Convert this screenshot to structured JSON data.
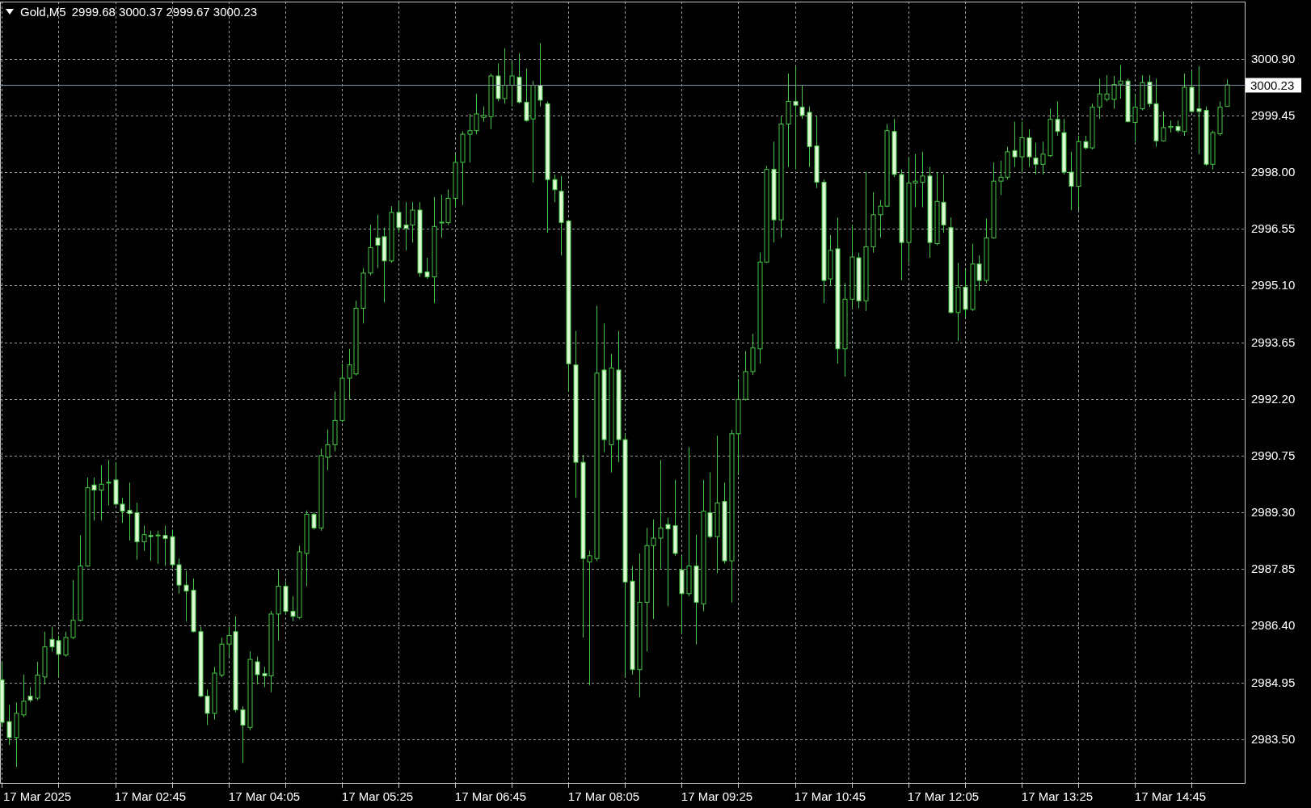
{
  "chart": {
    "header": {
      "symbol": "Gold,M5",
      "ohlc": "2999.68 3000.37 2999.67 3000.23"
    },
    "chart_data": {
      "type": "candlestick",
      "grid": true,
      "ylim": [
        2982.36,
        3002.36
      ],
      "categories": [
        null,
        null,
        null,
        null,
        null,
        "17 Mar 2025",
        null,
        null,
        null,
        null,
        null,
        null,
        null,
        null,
        null,
        null,
        null,
        null,
        null,
        null,
        null,
        "17 Mar 02:45",
        null,
        null,
        null,
        null,
        null,
        null,
        null,
        null,
        null,
        null,
        null,
        null,
        null,
        null,
        null,
        "17 Mar 04:05",
        null,
        null,
        null,
        null,
        null,
        null,
        null,
        null,
        null,
        null,
        null,
        null,
        null,
        null,
        null,
        "17 Mar 05:25",
        null,
        null,
        null,
        null,
        null,
        null,
        null,
        null,
        null,
        null,
        null,
        null,
        null,
        null,
        null,
        "17 Mar 06:45",
        null,
        null,
        null,
        null,
        null,
        null,
        null,
        null,
        null,
        null,
        null,
        null,
        null,
        null,
        null,
        "17 Mar 08:05",
        null,
        null,
        null,
        null,
        null,
        null,
        null,
        null,
        null,
        null,
        null,
        null,
        null,
        null,
        null,
        "17 Mar 09:25",
        null,
        null,
        null,
        null,
        null,
        null,
        null,
        null,
        null,
        null,
        null,
        null,
        null,
        null,
        null,
        "17 Mar 10:45",
        null,
        null,
        null,
        null,
        null,
        null,
        null,
        null,
        null,
        null,
        null,
        null,
        null,
        null,
        null,
        "17 Mar 12:05",
        null,
        null,
        null,
        null,
        null,
        null,
        null,
        null,
        null,
        null,
        null,
        null,
        null,
        null,
        null,
        "17 Mar 13:25",
        null,
        null,
        null,
        null,
        null,
        null,
        null,
        null,
        null,
        null,
        null,
        null,
        null,
        null,
        null,
        "17 Mar 14:45",
        null,
        null,
        null,
        null,
        null,
        null,
        null,
        null
      ],
      "yticks": [
        {
          "value": 3000.9,
          "label": "3000.90"
        },
        {
          "value": 2999.45,
          "label": "2999.45"
        },
        {
          "value": 2998,
          "label": "2998.00"
        },
        {
          "value": 2996.55,
          "label": "2996.55"
        },
        {
          "value": 2995.1,
          "label": "2995.10"
        },
        {
          "value": 2993.65,
          "label": "2993.65"
        },
        {
          "value": 2992.2,
          "label": "2992.20"
        },
        {
          "value": 2990.75,
          "label": "2990.75"
        },
        {
          "value": 2989.3,
          "label": "2989.30"
        },
        {
          "value": 2987.85,
          "label": "2987.85"
        },
        {
          "value": 2986.4,
          "label": "2986.40"
        },
        {
          "value": 2984.95,
          "label": "2984.95"
        },
        {
          "value": 2983.5,
          "label": "2983.50"
        }
      ],
      "ohlc": [
        [
          2985.02,
          2985.48,
          2983.8,
          2983.93
        ],
        [
          2983.95,
          2984.38,
          2983.35,
          2983.54
        ],
        [
          2983.54,
          2984.44,
          2982.79,
          2984.16
        ],
        [
          2984.12,
          2985.15,
          2984.06,
          2984.47
        ],
        [
          2984.6,
          2984.83,
          2984.44,
          2984.5
        ],
        [
          2984.55,
          2985.48,
          2984.5,
          2985.14
        ],
        [
          2985.09,
          2986.25,
          2984.9,
          2985.86
        ],
        [
          2986.05,
          2986.38,
          2985.74,
          2985.86
        ],
        [
          2986.02,
          2986.15,
          2985.09,
          2985.67
        ],
        [
          2985.65,
          2986.25,
          2985.61,
          2986.1
        ],
        [
          2986.1,
          2987.57,
          2986.06,
          2986.54
        ],
        [
          2986.54,
          2988.71,
          2986.51,
          2987.93
        ],
        [
          2987.93,
          2990.19,
          2987.91,
          2989.93
        ],
        [
          2990.0,
          2990.19,
          2989.09,
          2989.87
        ],
        [
          2989.87,
          2990.51,
          2989.09,
          2990.02
        ],
        [
          2990.06,
          2990.64,
          2989.48,
          2990.07
        ],
        [
          2990.13,
          2990.58,
          2989.48,
          2989.51
        ],
        [
          2989.51,
          2989.67,
          2989.03,
          2989.33
        ],
        [
          2989.35,
          2990.06,
          2988.58,
          2989.27
        ],
        [
          2989.29,
          2989.54,
          2988.09,
          2988.55
        ],
        [
          2988.55,
          2988.96,
          2988.32,
          2988.73
        ],
        [
          2988.71,
          2988.83,
          2988.06,
          2988.68
        ],
        [
          2988.71,
          2988.83,
          2987.99,
          2988.72
        ],
        [
          2988.71,
          2988.96,
          2987.93,
          2988.63
        ],
        [
          2988.68,
          2988.86,
          2987.87,
          2987.96
        ],
        [
          2987.96,
          2988.12,
          2987.22,
          2987.44
        ],
        [
          2987.44,
          2987.8,
          2986.51,
          2987.29
        ],
        [
          2987.31,
          2987.61,
          2986.23,
          2986.25
        ],
        [
          2986.25,
          2986.38,
          2984.57,
          2984.6
        ],
        [
          2984.6,
          2984.77,
          2983.86,
          2984.16
        ],
        [
          2984.16,
          2985.35,
          2984.0,
          2985.19
        ],
        [
          2985.14,
          2986.1,
          2985.09,
          2985.93
        ],
        [
          2985.93,
          2986.38,
          2985.61,
          2986.15
        ],
        [
          2986.25,
          2986.64,
          2984.19,
          2984.25
        ],
        [
          2984.25,
          2984.34,
          2982.89,
          2983.86
        ],
        [
          2983.8,
          2985.74,
          2983.73,
          2985.54
        ],
        [
          2985.48,
          2985.61,
          2984.9,
          2985.15
        ],
        [
          2985.18,
          2985.35,
          2984.83,
          2985.12
        ],
        [
          2985.12,
          2986.78,
          2984.7,
          2986.7
        ],
        [
          2986.7,
          2987.83,
          2986.02,
          2987.41
        ],
        [
          2987.41,
          2987.54,
          2986.7,
          2986.77
        ],
        [
          2986.77,
          2987.16,
          2986.51,
          2986.64
        ],
        [
          2986.61,
          2988.45,
          2986.57,
          2988.29
        ],
        [
          2988.25,
          2989.35,
          2987.41,
          2989.25
        ],
        [
          2989.25,
          2989.3,
          2988.86,
          2988.9
        ],
        [
          2988.9,
          2990.93,
          2988.83,
          2990.75
        ],
        [
          2990.71,
          2991.42,
          2990.38,
          2991.03
        ],
        [
          2991.03,
          2992.39,
          2990.86,
          2991.65
        ],
        [
          2991.65,
          2993.1,
          2991.61,
          2992.73
        ],
        [
          2992.73,
          2993.48,
          2992.19,
          2993.07
        ],
        [
          2992.84,
          2994.71,
          2992.8,
          2994.52
        ],
        [
          2994.52,
          2995.55,
          2994.13,
          2995.42
        ],
        [
          2995.42,
          2996.65,
          2995.36,
          2996.07
        ],
        [
          2996.32,
          2996.91,
          2995.55,
          2996.13
        ],
        [
          2996.35,
          2996.58,
          2994.67,
          2995.73
        ],
        [
          2995.73,
          2997.13,
          2995.68,
          2996.97
        ],
        [
          2996.97,
          2997.25,
          2996.45,
          2996.58
        ],
        [
          2996.65,
          2997.23,
          2996.0,
          2996.56
        ],
        [
          2996.65,
          2997.23,
          2996.2,
          2997.03
        ],
        [
          2997.03,
          2997.23,
          2995.32,
          2995.42
        ],
        [
          2995.45,
          2995.81,
          2995.27,
          2995.32
        ],
        [
          2995.32,
          2997.36,
          2994.65,
          2996.61
        ],
        [
          2996.71,
          2997.42,
          2996.32,
          2996.72
        ],
        [
          2996.71,
          2997.55,
          2996.65,
          2997.33
        ],
        [
          2997.33,
          2998.46,
          2997.1,
          2998.25
        ],
        [
          2998.25,
          2999.04,
          2997.16,
          2998.97
        ],
        [
          2998.97,
          2999.49,
          2998.25,
          2999.06
        ],
        [
          2999.06,
          3000.0,
          2998.97,
          2999.49
        ],
        [
          2999.4,
          2999.68,
          2999.29,
          2999.45
        ],
        [
          2999.42,
          3000.52,
          2999.1,
          3000.46
        ],
        [
          3000.46,
          3000.78,
          2999.81,
          2999.88
        ],
        [
          2999.88,
          3001.17,
          2999.75,
          3000.22
        ],
        [
          3000.22,
          3000.84,
          2999.68,
          3000.46
        ],
        [
          3000.43,
          3001.04,
          2999.75,
          2999.79
        ],
        [
          2999.79,
          3000.65,
          2999.29,
          2999.32
        ],
        [
          2999.36,
          3000.33,
          2997.74,
          3000.22
        ],
        [
          3000.22,
          3001.3,
          2999.68,
          2999.84
        ],
        [
          2999.75,
          2999.81,
          2996.45,
          2997.81
        ],
        [
          2997.81,
          2997.94,
          2997.23,
          2997.55
        ],
        [
          2997.51,
          2997.9,
          2995.87,
          2996.71
        ],
        [
          2996.75,
          2996.78,
          2992.39,
          2993.1
        ],
        [
          2993.07,
          2993.94,
          2989.67,
          2990.58
        ],
        [
          2990.58,
          2990.77,
          2986.1,
          2988.12
        ],
        [
          2988.03,
          2988.32,
          2984.87,
          2988.19
        ],
        [
          2988.12,
          2994.58,
          2988.06,
          2992.86
        ],
        [
          2992.94,
          2994.13,
          2990.84,
          2991.16
        ],
        [
          2991.03,
          2993.35,
          2990.32,
          2992.99
        ],
        [
          2992.94,
          2993.94,
          2990.58,
          2991.16
        ],
        [
          2991.16,
          2991.29,
          2985.09,
          2987.52
        ],
        [
          2987.54,
          2987.93,
          2985.15,
          2985.28
        ],
        [
          2985.28,
          2988.25,
          2984.57,
          2987.0
        ],
        [
          2987.0,
          2988.9,
          2985.74,
          2988.45
        ],
        [
          2988.45,
          2989.12,
          2986.57,
          2988.64
        ],
        [
          2988.64,
          2990.64,
          2987.87,
          2988.9
        ],
        [
          2988.99,
          2989.16,
          2986.9,
          2988.88
        ],
        [
          2988.96,
          2990.13,
          2988.19,
          2988.25
        ],
        [
          2987.83,
          2988.21,
          2986.19,
          2987.22
        ],
        [
          2987.22,
          2990.97,
          2987.16,
          2987.93
        ],
        [
          2987.93,
          2988.73,
          2985.93,
          2987.0
        ],
        [
          2986.96,
          2990.13,
          2986.77,
          2989.33
        ],
        [
          2989.29,
          2990.32,
          2988.64,
          2988.68
        ],
        [
          2988.68,
          2991.26,
          2987.74,
          2989.54
        ],
        [
          2989.58,
          2990.06,
          2987.99,
          2988.06
        ],
        [
          2988.06,
          2991.41,
          2987.0,
          2991.31
        ],
        [
          2991.31,
          2992.71,
          2990.25,
          2992.19
        ],
        [
          2992.19,
          2993.42,
          2992.16,
          2992.9
        ],
        [
          2992.9,
          2993.87,
          2992.81,
          2993.51
        ],
        [
          2993.48,
          2995.94,
          2993.1,
          2995.7
        ],
        [
          2995.7,
          2998.16,
          2995.68,
          2998.07
        ],
        [
          2998.07,
          2998.78,
          2996.2,
          2996.78
        ],
        [
          2996.78,
          2999.42,
          2996.32,
          2999.23
        ],
        [
          2999.23,
          3000.52,
          2998.13,
          2999.81
        ],
        [
          2999.81,
          3000.71,
          2998.07,
          2999.71
        ],
        [
          2999.66,
          3000.22,
          2999.36,
          2999.45
        ],
        [
          2999.53,
          2999.68,
          2998.13,
          2998.65
        ],
        [
          2998.67,
          2999.42,
          2997.59,
          2997.74
        ],
        [
          2997.74,
          2997.81,
          2994.65,
          2995.23
        ],
        [
          2995.27,
          2996.39,
          2995.1,
          2996.0
        ],
        [
          2996.04,
          2996.84,
          2993.1,
          2993.48
        ],
        [
          2993.48,
          2995.16,
          2992.77,
          2994.75
        ],
        [
          2994.75,
          2996.65,
          2994.52,
          2995.83
        ],
        [
          2995.81,
          2995.94,
          2994.52,
          2994.71
        ],
        [
          2994.71,
          2998.0,
          2994.45,
          2996.09
        ],
        [
          2996.09,
          2997.49,
          2995.94,
          2996.91
        ],
        [
          2996.91,
          2997.29,
          2996.32,
          2997.13
        ],
        [
          2997.13,
          2999.23,
          2997.1,
          2999.06
        ],
        [
          2999.04,
          2999.36,
          2997.87,
          2997.94
        ],
        [
          2997.94,
          2998.07,
          2995.23,
          2996.2
        ],
        [
          2996.2,
          2998.39,
          2995.68,
          2997.72
        ],
        [
          2997.72,
          2998.46,
          2997.1,
          2997.77
        ],
        [
          2997.74,
          2998.52,
          2997.1,
          2997.9
        ],
        [
          2997.9,
          2998.13,
          2995.81,
          2996.2
        ],
        [
          2996.17,
          2998.0,
          2996.13,
          2997.25
        ],
        [
          2997.23,
          2997.94,
          2996.45,
          2996.65
        ],
        [
          2996.58,
          2996.84,
          2994.39,
          2994.41
        ],
        [
          2994.41,
          2995.68,
          2993.68,
          2995.06
        ],
        [
          2995.06,
          2995.55,
          2994.28,
          2994.49
        ],
        [
          2994.49,
          2996.17,
          2994.45,
          2995.65
        ],
        [
          2995.65,
          2995.87,
          2994.97,
          2995.23
        ],
        [
          2995.23,
          2996.81,
          2995.16,
          2996.32
        ],
        [
          2996.32,
          2998.25,
          2996.3,
          2997.77
        ],
        [
          2997.77,
          2998.29,
          2997.42,
          2997.87
        ],
        [
          2997.87,
          2998.65,
          2997.81,
          2998.52
        ],
        [
          2998.55,
          2999.29,
          2998.13,
          2998.39
        ],
        [
          2998.39,
          2999.29,
          2998.0,
          2998.88
        ],
        [
          2998.88,
          2999.1,
          2998.13,
          2998.39
        ],
        [
          2998.36,
          2998.75,
          2997.94,
          2998.2
        ],
        [
          2998.2,
          2998.78,
          2997.94,
          2998.46
        ],
        [
          2998.42,
          2999.62,
          2998.39,
          2999.35
        ],
        [
          2999.35,
          2999.81,
          2998.93,
          2999.04
        ],
        [
          2999.01,
          2999.36,
          2997.94,
          2998.0
        ],
        [
          2998.0,
          2998.52,
          2997.03,
          2997.64
        ],
        [
          2997.64,
          2998.93,
          2997.03,
          2998.78
        ],
        [
          2998.78,
          2998.93,
          2998.58,
          2998.62
        ],
        [
          2998.62,
          2999.75,
          2998.58,
          2999.66
        ],
        [
          2999.66,
          3000.39,
          2999.36,
          3000.0
        ],
        [
          2999.86,
          3000.48,
          2999.81,
          3000.0
        ],
        [
          2999.86,
          3000.46,
          2999.62,
          3000.24
        ],
        [
          3000.25,
          3000.74,
          2999.88,
          3000.33
        ],
        [
          3000.33,
          3000.39,
          2999.27,
          2999.29
        ],
        [
          2999.27,
          3000.0,
          2998.78,
          2999.66
        ],
        [
          2999.62,
          3000.48,
          2999.58,
          3000.29
        ],
        [
          3000.3,
          3000.48,
          2999.66,
          2999.75
        ],
        [
          2999.75,
          3000.39,
          2998.65,
          2998.8
        ],
        [
          2998.8,
          2999.55,
          2998.78,
          2999.14
        ],
        [
          2999.14,
          2999.32,
          2999.01,
          2999.17
        ],
        [
          2999.17,
          2999.32,
          2999.01,
          2999.06
        ],
        [
          2999.04,
          3000.52,
          2998.93,
          3000.17
        ],
        [
          3000.17,
          3000.59,
          2999.53,
          2999.55
        ],
        [
          2999.62,
          3000.71,
          2998.46,
          2999.55
        ],
        [
          2999.58,
          2999.68,
          2998.16,
          2998.2
        ],
        [
          2998.2,
          2999.06,
          2998.07,
          2999.01
        ],
        [
          2998.98,
          2999.81,
          2998.93,
          2999.66
        ],
        [
          2999.68,
          3000.37,
          2999.67,
          3000.23
        ]
      ],
      "ref_lines": [
        {
          "axis": "y",
          "value": 3000.23,
          "label": "3000.23",
          "color": "#7c8ea0"
        }
      ]
    }
  }
}
